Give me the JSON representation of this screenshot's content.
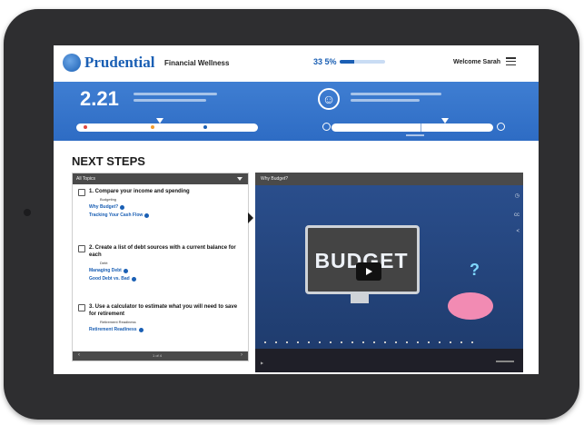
{
  "header": {
    "brand": "Prudential",
    "app_name": "Financial Wellness",
    "progress_label": "33 5%",
    "progress_value": 0.335,
    "welcome": "Welcome Sarah"
  },
  "banner": {
    "score": "2.21",
    "scale_labels": [
      "",
      "",
      ""
    ],
    "colors": {
      "banner": "#3f7ed2",
      "low": "#e0463f",
      "mid": "#f29b2e",
      "high": "#1a5fb4"
    }
  },
  "next_steps": {
    "title": "NEXT STEPS",
    "filter": "All Topics",
    "tasks": [
      {
        "title": "1. Compare your income and spending",
        "meta": "Budgeting",
        "links": [
          "Why Budget?",
          "Tracking Your Cash Flow"
        ]
      },
      {
        "title": "2. Create a list of debt sources with a current balance for each",
        "meta": "Debt",
        "links": [
          "Managing Debt",
          "Good Debt vs. Bad"
        ]
      },
      {
        "title": "3. Use a calculator to estimate what you will need to save for retirement",
        "meta": "Retirement Readiness",
        "links": [
          "Retirement Readiness"
        ]
      }
    ],
    "footer_page": "1 of 4"
  },
  "video": {
    "title": "Why Budget?",
    "screen_text": "BUDGET"
  }
}
